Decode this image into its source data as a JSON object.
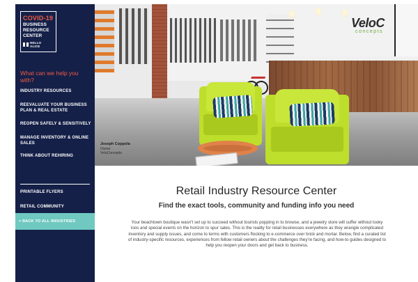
{
  "sidebar": {
    "logo": {
      "title": "COVID-19",
      "subtitle_lines": [
        "BUSINESS",
        "RESOURCE",
        "CENTER"
      ],
      "brand_lines": [
        "HELLO",
        "ALICE"
      ]
    },
    "help_heading": "What can we help you with?",
    "nav_items": [
      {
        "label": "INDUSTRY RESOURCES"
      },
      {
        "label": "REEVALUATE YOUR BUSINESS PLAN & REAL ESTATE"
      },
      {
        "label": "REOPEN SAFELY & SENSITIVELY"
      },
      {
        "label": "MANAGE INVENTORY & ONLINE SALES"
      },
      {
        "label": "THINK ABOUT REHIRING"
      }
    ],
    "sub_links": [
      {
        "label": "PRINTABLE FLYERS"
      },
      {
        "label": "RETAIL COMMUNITY"
      }
    ],
    "back_link": "< BACK TO ALL INDUSTRIES",
    "colors": {
      "background": "#152048",
      "accent": "#ef5b45",
      "back_link_bg": "#6fc9c0"
    }
  },
  "hero": {
    "store_logo_main": "VeloC",
    "store_logo_sub": "concepts",
    "caption": {
      "name": "Joseph Coppola",
      "role": "Owner",
      "company": "VeloConcepts"
    }
  },
  "content": {
    "title": "Retail Industry Resource Center",
    "subtitle": "Find the exact tools, community and funding info you need",
    "body": "Your beachtown boutique wasn't set up to succeed without tourists popping in to browse, and a jewelry store will suffer without looky loos and special events on the horizon to spur sales. This is the reality for retail businesses everywhere as they wrangle complicated inventory and supply issues, and come to terms with customers flocking to e-commerce over brick and mortar. Below, find a curated list of industry-specific resources, experiences from fellow retail owners about the challenges they're facing, and how-to guides designed to help you reopen your doors and get back to business."
  }
}
